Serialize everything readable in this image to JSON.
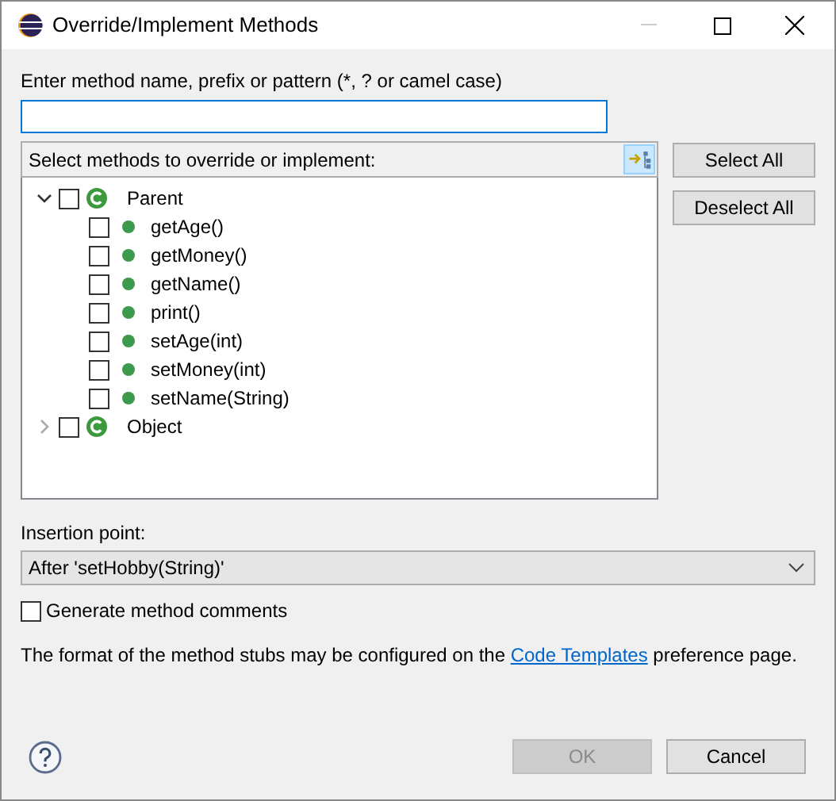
{
  "window": {
    "title": "Override/Implement Methods"
  },
  "filter": {
    "label": "Enter method name, prefix or pattern (*, ? or camel case)"
  },
  "tree": {
    "label": "Select methods to override or implement:",
    "items": [
      {
        "label": "Parent",
        "kind": "class",
        "expanded": true,
        "checked": false,
        "children": [
          {
            "label": "getAge()",
            "kind": "method",
            "checked": false
          },
          {
            "label": "getMoney()",
            "kind": "method",
            "checked": false
          },
          {
            "label": "getName()",
            "kind": "method",
            "checked": false
          },
          {
            "label": "print()",
            "kind": "method",
            "checked": false
          },
          {
            "label": "setAge(int)",
            "kind": "method",
            "checked": false
          },
          {
            "label": "setMoney(int)",
            "kind": "method",
            "checked": false
          },
          {
            "label": "setName(String)",
            "kind": "method",
            "checked": false
          }
        ]
      },
      {
        "label": "Object",
        "kind": "class",
        "expanded": false,
        "checked": false
      }
    ]
  },
  "side_buttons": [
    "Select All",
    "Deselect All"
  ],
  "insertion": {
    "label": "Insertion point:",
    "value": "After 'setHobby(String)'"
  },
  "generate_comments": {
    "label": "Generate method comments",
    "checked": false
  },
  "info": {
    "before": "The format of the method stubs may be configured on the",
    "link": "Code Templates",
    "after": "preference page."
  },
  "buttons": [
    {
      "label": "OK",
      "disabled": true
    },
    {
      "label": "Cancel",
      "disabled": false
    }
  ]
}
